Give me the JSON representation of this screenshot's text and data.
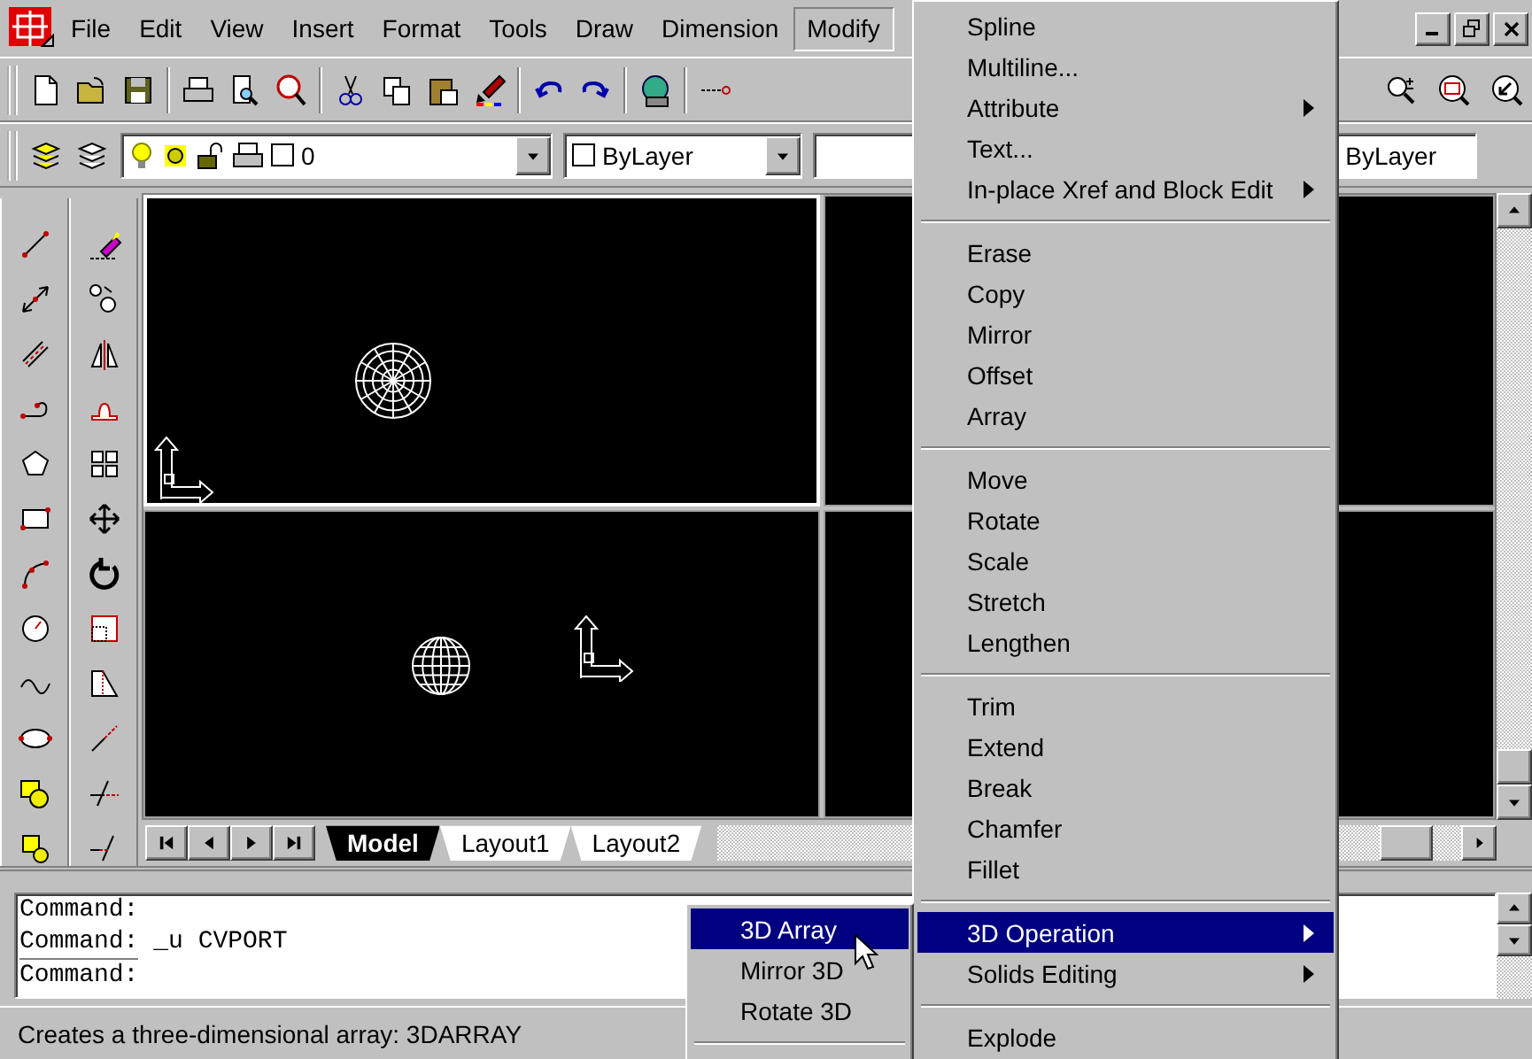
{
  "menubar": {
    "items": [
      {
        "label": "File",
        "selected": false
      },
      {
        "label": "Edit",
        "selected": false
      },
      {
        "label": "View",
        "selected": false
      },
      {
        "label": "Insert",
        "selected": false
      },
      {
        "label": "Format",
        "selected": false
      },
      {
        "label": "Tools",
        "selected": false
      },
      {
        "label": "Draw",
        "selected": false
      },
      {
        "label": "Dimension",
        "selected": false
      },
      {
        "label": "Modify",
        "selected": true
      }
    ]
  },
  "properties_toolbar": {
    "layer": "0",
    "color_name": "ByLayer",
    "linetype": "ByLayer"
  },
  "viewports": [
    {
      "active": true,
      "kind": "plan"
    },
    {
      "active": false,
      "kind": "empty"
    },
    {
      "active": false,
      "kind": "elevation"
    },
    {
      "active": false,
      "kind": "empty"
    }
  ],
  "layout_tabs": [
    {
      "label": "Model",
      "selected": true
    },
    {
      "label": "Layout1",
      "selected": false
    },
    {
      "label": "Layout2",
      "selected": false
    }
  ],
  "command_history": [
    "Command:",
    "Command: _u CVPORT"
  ],
  "command_prompt": "Command:",
  "status_bar": "Creates a three-dimensional array:  3DARRAY",
  "modify_menu": {
    "items": [
      {
        "kind": "item",
        "label": "Spline",
        "submenu": false,
        "selected": false
      },
      {
        "kind": "item",
        "label": "Multiline...",
        "submenu": false,
        "selected": false
      },
      {
        "kind": "item",
        "label": "Attribute",
        "submenu": true,
        "selected": false
      },
      {
        "kind": "item",
        "label": "Text...",
        "submenu": false,
        "selected": false
      },
      {
        "kind": "item",
        "label": "In-place Xref and Block Edit",
        "submenu": true,
        "selected": false
      },
      {
        "kind": "separator"
      },
      {
        "kind": "item",
        "label": "Erase",
        "submenu": false,
        "selected": false
      },
      {
        "kind": "item",
        "label": "Copy",
        "submenu": false,
        "selected": false
      },
      {
        "kind": "item",
        "label": "Mirror",
        "submenu": false,
        "selected": false
      },
      {
        "kind": "item",
        "label": "Offset",
        "submenu": false,
        "selected": false
      },
      {
        "kind": "item",
        "label": "Array",
        "submenu": false,
        "selected": false
      },
      {
        "kind": "separator"
      },
      {
        "kind": "item",
        "label": "Move",
        "submenu": false,
        "selected": false
      },
      {
        "kind": "item",
        "label": "Rotate",
        "submenu": false,
        "selected": false
      },
      {
        "kind": "item",
        "label": "Scale",
        "submenu": false,
        "selected": false
      },
      {
        "kind": "item",
        "label": "Stretch",
        "submenu": false,
        "selected": false
      },
      {
        "kind": "item",
        "label": "Lengthen",
        "submenu": false,
        "selected": false
      },
      {
        "kind": "separator"
      },
      {
        "kind": "item",
        "label": "Trim",
        "submenu": false,
        "selected": false
      },
      {
        "kind": "item",
        "label": "Extend",
        "submenu": false,
        "selected": false
      },
      {
        "kind": "item",
        "label": "Break",
        "submenu": false,
        "selected": false
      },
      {
        "kind": "item",
        "label": "Chamfer",
        "submenu": false,
        "selected": false
      },
      {
        "kind": "item",
        "label": "Fillet",
        "submenu": false,
        "selected": false
      },
      {
        "kind": "separator"
      },
      {
        "kind": "item",
        "label": "3D Operation",
        "submenu": true,
        "selected": true
      },
      {
        "kind": "item",
        "label": "Solids Editing",
        "submenu": true,
        "selected": false
      },
      {
        "kind": "separator"
      },
      {
        "kind": "item",
        "label": "Explode",
        "submenu": false,
        "selected": false
      }
    ]
  },
  "operation_submenu": {
    "items": [
      {
        "kind": "item",
        "label": "3D Array",
        "selected": true
      },
      {
        "kind": "item",
        "label": "Mirror 3D",
        "selected": false
      },
      {
        "kind": "item",
        "label": "Rotate 3D",
        "selected": false
      },
      {
        "kind": "separator"
      }
    ]
  }
}
